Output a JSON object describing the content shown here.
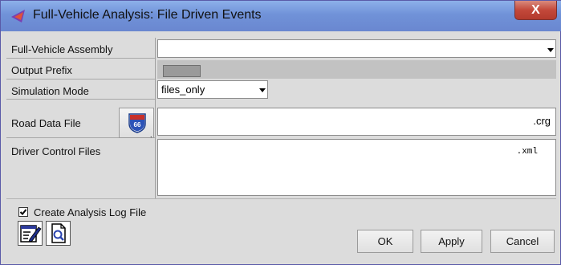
{
  "window": {
    "title": "Full-Vehicle Analysis: File Driven Events",
    "close_label": "X"
  },
  "form": {
    "assembly_label": "Full-Vehicle Assembly",
    "assembly_value": "",
    "prefix_label": "Output Prefix",
    "mode_label": "Simulation Mode",
    "mode_value": "files_only",
    "road_label": "Road Data File",
    "road_suffix": ".crg",
    "driver_label": "Driver Control Files",
    "driver_suffix": ".xml"
  },
  "options": {
    "log_label": "Create Analysis Log File",
    "log_checked": true
  },
  "buttons": {
    "ok": "OK",
    "apply": "Apply",
    "cancel": "Cancel"
  },
  "icons": {
    "road_browse": "route-66-sign-icon",
    "edit": "edit-document-icon",
    "view": "view-document-icon"
  }
}
